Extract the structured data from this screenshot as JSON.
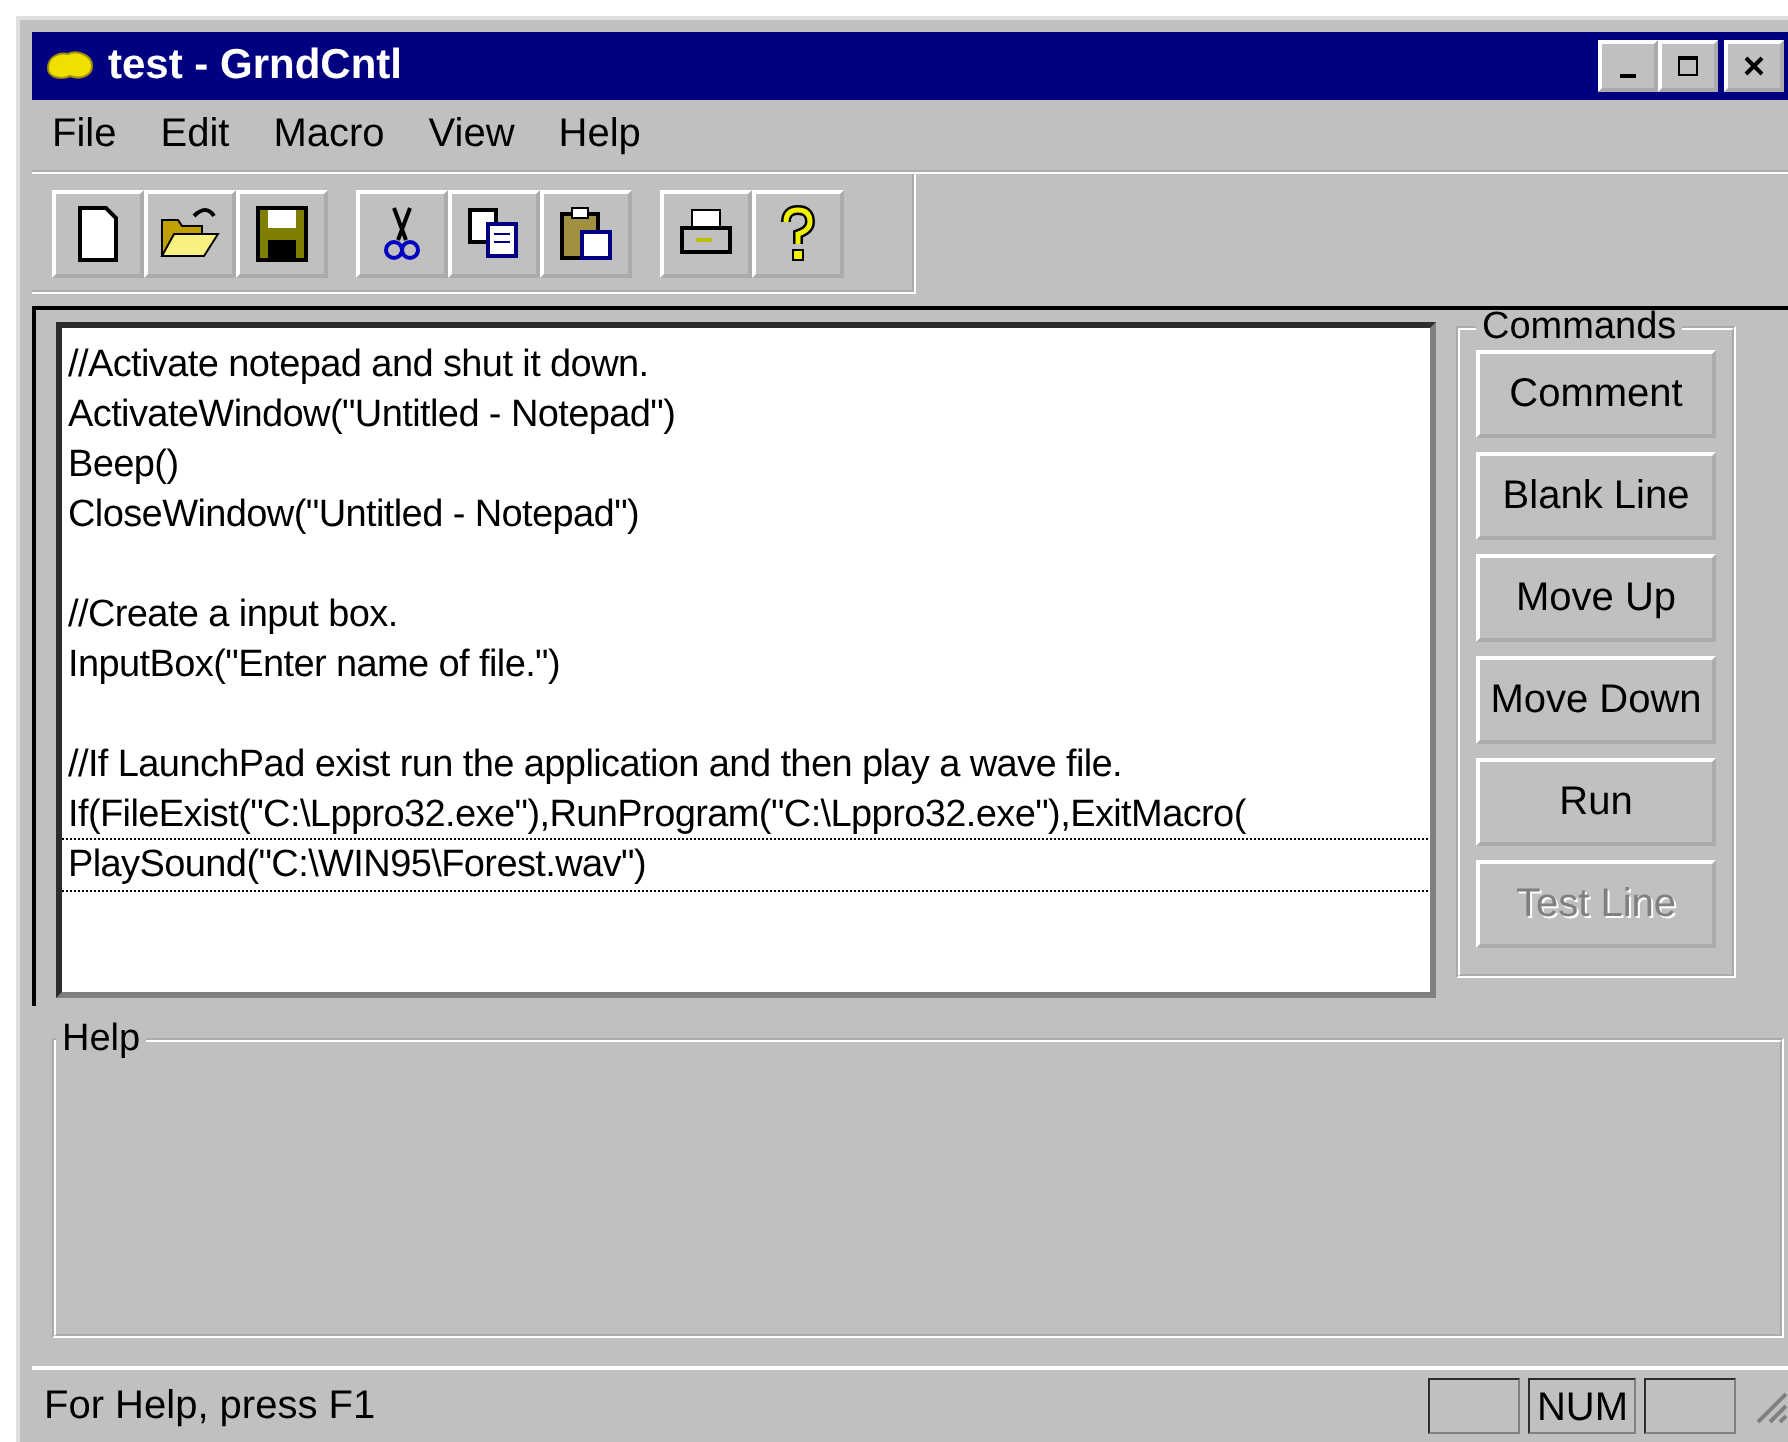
{
  "window": {
    "title": "test - GrndCntl"
  },
  "menu": [
    {
      "label": "File"
    },
    {
      "label": "Edit"
    },
    {
      "label": "Macro"
    },
    {
      "label": "View"
    },
    {
      "label": "Help"
    }
  ],
  "editor": {
    "blocks": [
      [
        {
          "text": "//Activate notepad and shut it down.",
          "focused": false
        },
        {
          "text": "ActivateWindow(\"Untitled - Notepad\")",
          "focused": false
        },
        {
          "text": "Beep()",
          "focused": false
        },
        {
          "text": "CloseWindow(\"Untitled - Notepad\")",
          "focused": false
        }
      ],
      [
        {
          "text": "//Create a input box.",
          "focused": false
        },
        {
          "text": "InputBox(\"Enter name of file.\")",
          "focused": false
        }
      ],
      [
        {
          "text": "//If LaunchPad exist run the application and then play a wave file.",
          "focused": false
        },
        {
          "text": "If(FileExist(\"C:\\Lppro32.exe\"),RunProgram(\"C:\\Lppro32.exe\"),ExitMacro(",
          "focused": false
        },
        {
          "text": "PlaySound(\"C:\\WIN95\\Forest.wav\")",
          "focused": true
        }
      ]
    ]
  },
  "commands": {
    "title": "Commands",
    "buttons": [
      {
        "label": "Comment",
        "disabled": false
      },
      {
        "label": "Blank Line",
        "disabled": false
      },
      {
        "label": "Move Up",
        "disabled": false
      },
      {
        "label": "Move Down",
        "disabled": false
      },
      {
        "label": "Run",
        "disabled": false
      },
      {
        "label": "Test Line",
        "disabled": true
      }
    ]
  },
  "help": {
    "title": "Help"
  },
  "status_bar": {
    "text": "For Help, press F1",
    "indicators": [
      "NUM"
    ]
  }
}
